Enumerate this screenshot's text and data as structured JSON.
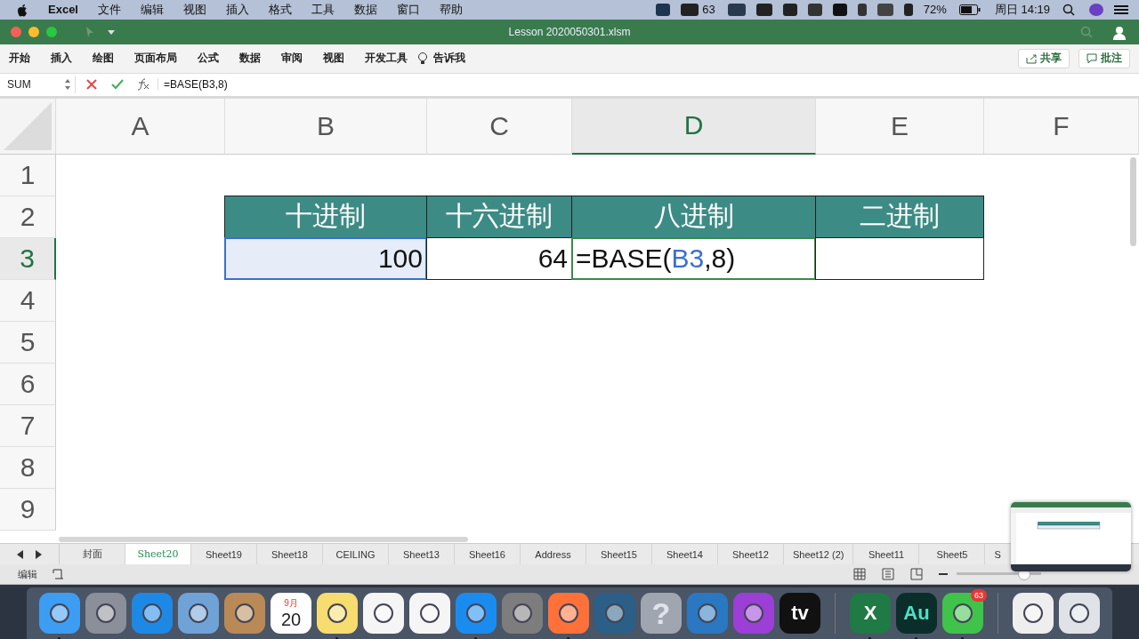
{
  "menu_bar": {
    "app": "Excel",
    "items": [
      "文件",
      "编辑",
      "视图",
      "插入",
      "格式",
      "工具",
      "数据",
      "窗口",
      "帮助"
    ],
    "wechat_count": "63",
    "battery": "72%",
    "clock": "周日 14:19"
  },
  "window": {
    "title": "Lesson 2020050301.xlsm"
  },
  "ribbon": {
    "tabs": [
      "开始",
      "插入",
      "绘图",
      "页面布局",
      "公式",
      "数据",
      "审阅",
      "视图",
      "开发工具"
    ],
    "tell_me": "告诉我",
    "buttons": [
      {
        "kind": "share",
        "label": "共享"
      },
      {
        "kind": "comment",
        "label": "批注"
      }
    ]
  },
  "formula_bar": {
    "name_box": "SUM",
    "formula": "=BASE(B3,8)"
  },
  "columns": [
    {
      "label": "A",
      "selected": false
    },
    {
      "label": "B",
      "selected": false
    },
    {
      "label": "C",
      "selected": false
    },
    {
      "label": "D",
      "selected": true
    },
    {
      "label": "E",
      "selected": false
    },
    {
      "label": "F",
      "selected": false
    }
  ],
  "rows": [
    {
      "label": "1",
      "selected": false
    },
    {
      "label": "2",
      "selected": false
    },
    {
      "label": "3",
      "selected": true
    },
    {
      "label": "4",
      "selected": false
    },
    {
      "label": "5",
      "selected": false
    },
    {
      "label": "6",
      "selected": false
    },
    {
      "label": "7",
      "selected": false
    },
    {
      "label": "8",
      "selected": false
    },
    {
      "label": "9",
      "selected": false
    }
  ],
  "table": [
    {
      "cells": [
        {
          "kind": "header",
          "parts": [
            {
              "text": "十进制"
            }
          ],
          "selected": false,
          "editing": false
        },
        {
          "kind": "header",
          "parts": [
            {
              "text": "十六进制"
            }
          ],
          "selected": false,
          "editing": false
        },
        {
          "kind": "header",
          "parts": [
            {
              "text": "八进制"
            }
          ],
          "selected": false,
          "editing": false
        },
        {
          "kind": "header",
          "parts": [
            {
              "text": "二进制"
            }
          ],
          "selected": false,
          "editing": false
        }
      ]
    },
    {
      "cells": [
        {
          "kind": "number",
          "parts": [
            {
              "text": "100"
            }
          ],
          "selected": true,
          "editing": false
        },
        {
          "kind": "number",
          "parts": [
            {
              "text": "64"
            }
          ],
          "selected": false,
          "editing": false
        },
        {
          "kind": "formula",
          "parts": [
            {
              "text": "=BASE(",
              "ref": false
            },
            {
              "text": "B3",
              "ref": true
            },
            {
              "text": ",8)",
              "ref": false
            }
          ],
          "selected": false,
          "editing": true
        },
        {
          "kind": "number",
          "selected": false,
          "editing": false
        }
      ]
    }
  ],
  "sheet_tabs": [
    {
      "label": "封面",
      "selected": false
    },
    {
      "label": "Sheet20",
      "selected": true
    },
    {
      "label": "Sheet19",
      "selected": false
    },
    {
      "label": "Sheet18",
      "selected": false
    },
    {
      "label": "CEILING",
      "selected": false
    },
    {
      "label": "Sheet13",
      "selected": false
    },
    {
      "label": "Sheet16",
      "selected": false
    },
    {
      "label": "Address",
      "selected": false
    },
    {
      "label": "Sheet15",
      "selected": false
    },
    {
      "label": "Sheet14",
      "selected": false
    },
    {
      "label": "Sheet12",
      "selected": false
    },
    {
      "label": "Sheet12 (2)",
      "selected": false
    },
    {
      "label": "Sheet11",
      "selected": false
    },
    {
      "label": "Sheet5",
      "selected": false
    },
    {
      "label": "S",
      "selected": false
    }
  ],
  "status_bar": {
    "mode": "编辑",
    "zoom": {
      "level": 0.8
    }
  },
  "dock": [
    {
      "kind": "finder",
      "color": "#3d9df3",
      "running": true
    },
    {
      "kind": "launchpad",
      "color": "#8a8f99",
      "running": false
    },
    {
      "kind": "safari",
      "color": "#1e88e5",
      "running": false
    },
    {
      "kind": "mail",
      "color": "#6fa3d8",
      "running": false
    },
    {
      "kind": "contacts",
      "color": "#b98a55",
      "running": false
    },
    {
      "kind": "calendar",
      "color": "#ffffff",
      "running": false,
      "month": "9月",
      "day": "20"
    },
    {
      "kind": "notes",
      "color": "#f7dc6f",
      "running": true
    },
    {
      "kind": "reminders",
      "color": "#f5f5f5",
      "running": false
    },
    {
      "kind": "photos",
      "color": "#f5f5f5",
      "running": false
    },
    {
      "kind": "appstore",
      "color": "#1a8cf0",
      "running": true
    },
    {
      "kind": "settings",
      "color": "#7d7d7d",
      "running": false
    },
    {
      "kind": "firefox",
      "color": "#ff7139",
      "running": true
    },
    {
      "kind": "mysql",
      "color": "#2b5f87",
      "running": false
    },
    {
      "kind": "help",
      "color": "#a0a6b0",
      "running": false,
      "glyph": "?"
    },
    {
      "kind": "clock",
      "color": "#2a78c2",
      "running": false
    },
    {
      "kind": "podcasts",
      "color": "#9b3fd6",
      "running": false
    },
    {
      "kind": "tv",
      "color": "#111111",
      "running": false,
      "glyph": "tv"
    },
    {
      "kind": "separator"
    },
    {
      "kind": "excel",
      "color": "#1f7a45",
      "running": true,
      "glyph": "X"
    },
    {
      "kind": "audition",
      "color": "#0b2e2b",
      "running": true,
      "glyph": "Au"
    },
    {
      "kind": "wechat",
      "color": "#3fc34a",
      "running": true,
      "badge": "63"
    },
    {
      "kind": "separator"
    },
    {
      "kind": "preview",
      "color": "#eeeeee",
      "running": false
    },
    {
      "kind": "trash",
      "color": "#dfe3e8",
      "running": false
    }
  ]
}
